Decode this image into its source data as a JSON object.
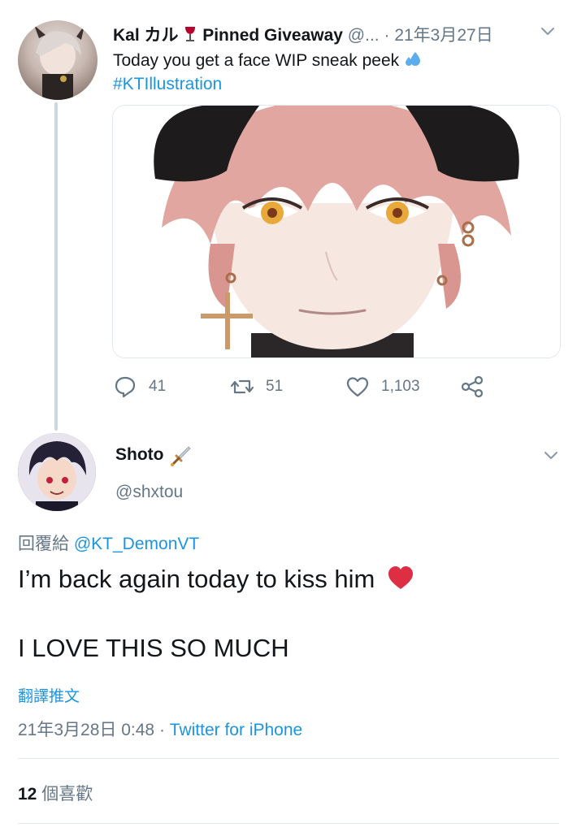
{
  "tweet1": {
    "display_name": "Kal カル",
    "name_emoji": "🍷",
    "pinned_label": "Pinned Giveaway",
    "handle": "@...",
    "separator": "·",
    "date": "21年3月27日",
    "text": "Today you get a face WIP sneak peek",
    "text_emoji": "💦",
    "hashtag": "#KTIllustration",
    "actions": {
      "reply_count": "41",
      "retweet_count": "51",
      "like_count": "1,103"
    }
  },
  "tweet2": {
    "display_name": "Shoto",
    "name_emoji": "🗡️",
    "handle": "@shxtou",
    "reply_prefix": "回覆給",
    "reply_to": "@KT_DemonVT",
    "body_line1": "I’m back again today to kiss him",
    "body_line1_emoji": "❤️",
    "body_line2": "I LOVE THIS SO MUCH",
    "translate_label": "翻譯推文",
    "timestamp": "21年3月28日 0:48",
    "separator": "·",
    "source": "Twitter for iPhone",
    "likes_count": "12",
    "likes_label": "個喜歡"
  },
  "colors": {
    "link_blue": "#1b95e0",
    "secondary_grey": "#657786",
    "divider": "#e1e8ed",
    "heart_red": "#dd2e44"
  },
  "icons": [
    "chevron-down-icon",
    "reply-icon",
    "retweet-icon",
    "like-icon",
    "share-icon",
    "wine-glass-emoji",
    "sweat-drops-emoji",
    "dagger-emoji",
    "red-heart-emoji"
  ]
}
